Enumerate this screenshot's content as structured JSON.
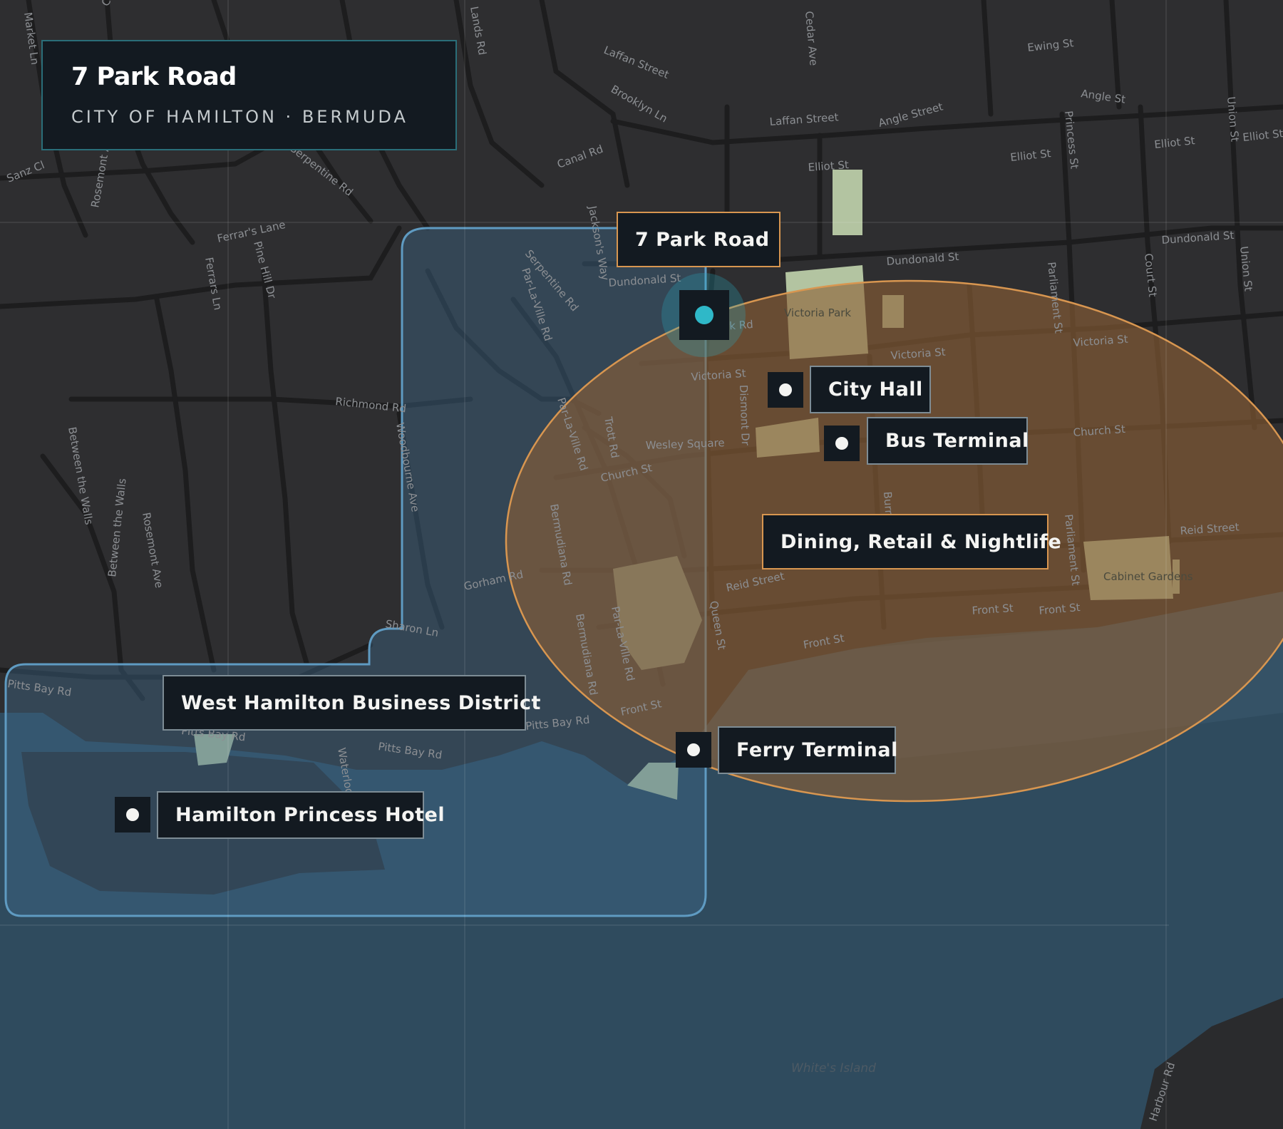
{
  "header": {
    "title": "7 Park Road",
    "subtitle": "CITY OF HAMILTON · BERMUDA"
  },
  "colors": {
    "land": "#2e2e30",
    "water": "#2f4b5e",
    "roads": "#1d1d1e",
    "west_zone_fill": "#3e6a8a",
    "west_zone_border": "#5f9bc2",
    "dining_zone_fill": "#8c6036",
    "dining_zone_border": "#d89650",
    "parks": "#b3c4a1",
    "marker_accent": "#2fb8c8",
    "label_bg": "#131a21"
  },
  "property": {
    "label": "7 Park Road",
    "marker_icon": "home-location-icon"
  },
  "zones": [
    {
      "id": "west",
      "label": "West Hamilton Business District"
    },
    {
      "id": "dining",
      "label": "Dining, Retail & Nightlife"
    }
  ],
  "pois": [
    {
      "id": "city-hall",
      "label": "City Hall",
      "icon": "pin-dot-icon"
    },
    {
      "id": "bus-terminal",
      "label": "Bus Terminal",
      "icon": "pin-dot-icon"
    },
    {
      "id": "ferry-terminal",
      "label": "Ferry Terminal",
      "icon": "pin-dot-icon"
    },
    {
      "id": "princess",
      "label": "Hamilton Princess Hotel",
      "icon": "pin-dot-icon"
    }
  ],
  "streets": [
    "Market Ln",
    "Cedar",
    "Sanz Cl",
    "Rosemont Ave",
    "Serpentine Rd",
    "Ferrar's Lane",
    "Ferrars Ln",
    "Pine Hill Dr",
    "Lands Rd",
    "Laffan Street",
    "Brooklyn Ln",
    "Canal Rd",
    "Jackson's Way",
    "Cedar Ave",
    "Laffan Street",
    "Angle Street",
    "Ewing St",
    "Angle St",
    "Union St",
    "Elliot St",
    "Elliot St",
    "Elliot St",
    "Elliot St",
    "Princess St",
    "Dundonald St",
    "Dundonald St",
    "Dundonald St",
    "Union St",
    "Parliament St",
    "Court St",
    "Serpentine Rd",
    "Par-La-Ville Rd",
    "Par-La-Ville Rd",
    "Victoria St",
    "Victoria St",
    "Victoria St",
    "Richmond Rd",
    "Woodbourne Ave",
    "Between the Walls",
    "Trott Rd",
    "Church St",
    "Church St",
    "Wesley Square",
    "Dismont Dr",
    "Bermudiana Rd",
    "Gorham Rd",
    "Reid Street",
    "Reid Street",
    "Front St",
    "Front St",
    "Front St",
    "Queen St",
    "Sharon Ln",
    "Pitts Bay Rd",
    "Pitts Bay Rd",
    "Pitts Bay Rd",
    "Pitts Bay Rd",
    "Waterloo",
    "Harbour Rd",
    "Burnaby",
    "Parliament St",
    "Cabinet Gardens",
    "Victoria Park",
    "Rosemont Ave",
    "Between the Walls",
    "Bermudiana Rd",
    "Par-La-Ville Rd",
    "Front St",
    "Park Rd"
  ],
  "landmarks": {
    "island": "White's Island"
  }
}
